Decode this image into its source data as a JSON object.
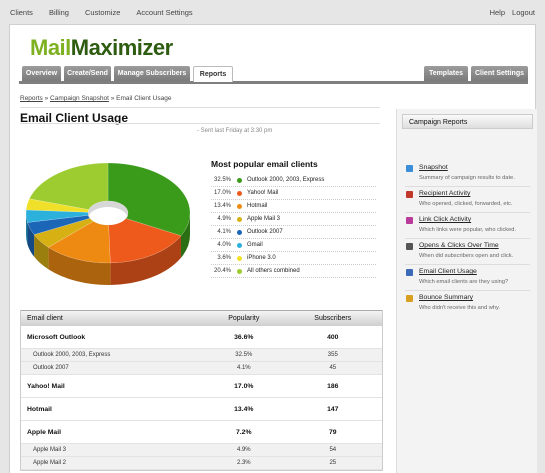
{
  "topnav": {
    "left": [
      "Clients",
      "Billing",
      "Customize",
      "Account Settings"
    ],
    "right": [
      "Help",
      "Logout"
    ]
  },
  "logo": {
    "part1": "Mail",
    "part2": "Maximizer"
  },
  "tabs_left": [
    "Overview",
    "Create/Send",
    "Manage Subscribers",
    "Reports"
  ],
  "tabs_right": [
    "Templates",
    "Client Settings"
  ],
  "active_tab": "Reports",
  "breadcrumb": {
    "root": "Reports",
    "sep1": "»",
    "mid": "Campaign Snapshot",
    "sep2": "»",
    "current": "Email Client Usage"
  },
  "page_title": "Email Client Usage",
  "sent": "- Sent last Friday at 3:30 pm",
  "colors": {
    "brand_green": "#7db122",
    "brand_dark": "#2e5c10",
    "tab_gray": "#8a8a8a"
  },
  "chart_data": {
    "type": "pie",
    "title": "Most popular email clients",
    "series": [
      {
        "label": "Outlook 2000, 2003, Express",
        "pct_label": "32.5%",
        "value": 32.5,
        "color": "#3a9a1a"
      },
      {
        "label": "Yahoo! Mail",
        "pct_label": "17.0%",
        "value": 17.0,
        "color": "#ee5a1c"
      },
      {
        "label": "Hotmail",
        "pct_label": "13.4%",
        "value": 13.4,
        "color": "#ee8a12"
      },
      {
        "label": "Apple Mail 3",
        "pct_label": "4.9%",
        "value": 4.9,
        "color": "#d7b014"
      },
      {
        "label": "Outlook 2007",
        "pct_label": "4.1%",
        "value": 4.1,
        "color": "#1c66b8"
      },
      {
        "label": "Gmail",
        "pct_label": "4.0%",
        "value": 4.0,
        "color": "#2cb0dc"
      },
      {
        "label": "iPhone 3.0",
        "pct_label": "3.6%",
        "value": 3.6,
        "color": "#f0e02a"
      },
      {
        "label": "All others combined",
        "pct_label": "20.4%",
        "value": 20.4,
        "color": "#9ccc30"
      }
    ]
  },
  "table": {
    "headers": [
      "Email client",
      "Popularity",
      "Subscribers"
    ],
    "rows": [
      {
        "kind": "group",
        "client": "Microsoft Outlook",
        "pop": "36.6%",
        "subs": "400"
      },
      {
        "kind": "sub",
        "client": "Outlook 2000, 2003, Express",
        "pop": "32.5%",
        "subs": "355"
      },
      {
        "kind": "sub",
        "client": "Outlook 2007",
        "pop": "4.1%",
        "subs": "45"
      },
      {
        "kind": "group",
        "client": "Yahoo! Mail",
        "pop": "17.0%",
        "subs": "186"
      },
      {
        "kind": "group",
        "client": "Hotmail",
        "pop": "13.4%",
        "subs": "147"
      },
      {
        "kind": "group",
        "client": "Apple Mail",
        "pop": "7.2%",
        "subs": "79"
      },
      {
        "kind": "sub",
        "client": "Apple Mail 3",
        "pop": "4.9%",
        "subs": "54"
      },
      {
        "kind": "sub",
        "client": "Apple Mail 2",
        "pop": "2.3%",
        "subs": "25"
      }
    ]
  },
  "sidebar": {
    "title": "Campaign Reports",
    "items": [
      {
        "label": "Snapshot",
        "desc": "Summary of campaign results to date.",
        "icon": "chart-icon",
        "color": "#3a8fd8"
      },
      {
        "label": "Recipient Activity",
        "desc": "Who opened, clicked, forwarded, etc.",
        "icon": "activity-icon",
        "color": "#c0392b"
      },
      {
        "label": "Link Click Activity",
        "desc": "Which links were popular, who clicked.",
        "icon": "link-icon",
        "color": "#b83a9a"
      },
      {
        "label": "Opens & Clicks Over Time",
        "desc": "When did subscribers open and click.",
        "icon": "clock-icon",
        "color": "#555555"
      },
      {
        "label": "Email Client Usage",
        "desc": "Which email clients are they using?",
        "icon": "envelope-icon",
        "color": "#3a6ab8"
      },
      {
        "label": "Bounce Summary",
        "desc": "Who didn't receive this and why.",
        "icon": "bounce-icon",
        "color": "#d8a020"
      }
    ]
  }
}
